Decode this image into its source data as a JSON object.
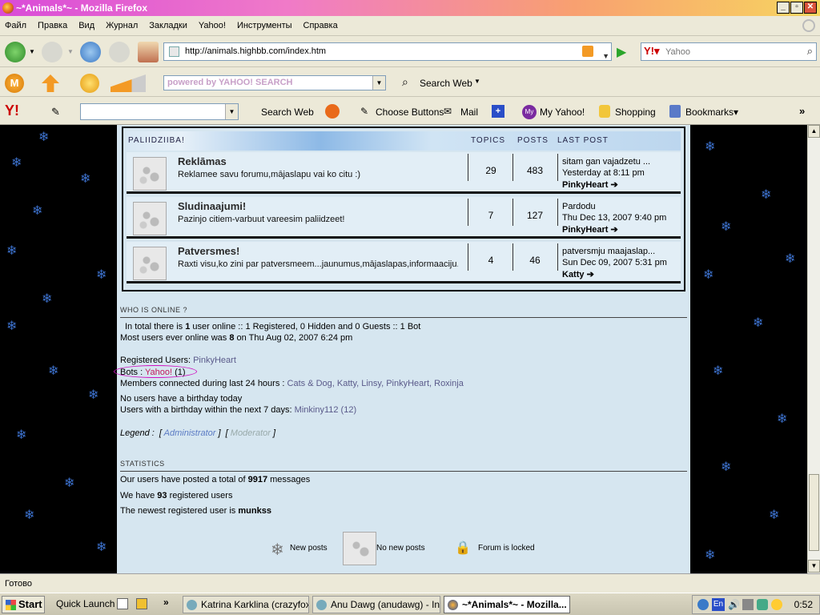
{
  "window": {
    "title": "~*Animals*~ - Mozilla Firefox"
  },
  "menu": [
    "Файл",
    "Правка",
    "Вид",
    "Журнал",
    "Закладки",
    "Yahoo!",
    "Инструменты",
    "Справка"
  ],
  "navigation": {
    "url": "http://animals.highbb.com/index.htm",
    "search_placeholder": "Yahoo"
  },
  "toolbar2": {
    "yahoo_search_label": "powered by YAHOO! SEARCH",
    "search_web": "Search Web"
  },
  "toolbar3": {
    "search_web": "Search Web",
    "choose_buttons": "Choose Buttons",
    "mail": "Mail",
    "my_yahoo": "My Yahoo!",
    "shopping": "Shopping",
    "bookmarks": "Bookmarks▾"
  },
  "forum": {
    "header": {
      "category": "PALIIDZIIBA!",
      "topics": "TOPICS",
      "posts": "POSTS",
      "last_post": "LAST POST"
    },
    "rows": [
      {
        "title": "Reklāmas",
        "desc": "Reklamee savu forumu,mājaslapu vai ko citu :)",
        "topics": "29",
        "posts": "483",
        "lp_title": "sitam gan vajadzetu ...",
        "lp_date": "Yesterday at 8:11 pm",
        "lp_user": "PinkyHeart"
      },
      {
        "title": "Sludinaajumi!",
        "desc": "Pazinjo citiem-varbuut vareesim paliidzeet!",
        "topics": "7",
        "posts": "127",
        "lp_title": "Pardodu",
        "lp_date": "Thu Dec 13, 2007 9:40 pm",
        "lp_user": "PinkyHeart"
      },
      {
        "title": "Patversmes!",
        "desc": "Raxti visu,ko zini par patversmeem...jaunumus,mājaslapas,informaaciju...",
        "topics": "4",
        "posts": "46",
        "lp_title": "patversmju maajaslap...",
        "lp_date": "Sun Dec 09, 2007 5:31 pm",
        "lp_user": "Katty"
      }
    ],
    "who_online": {
      "heading": "WHO IS ONLINE ?",
      "total_pre": "In total there is ",
      "total_num": "1",
      "total_post": " user online :: 1 Registered, 0 Hidden and 0 Guests :: 1 Bot",
      "most_pre": "Most users ever online was ",
      "most_num": "8",
      "most_post": " on Thu Aug 02, 2007 6:24 pm",
      "registered_label": "Registered Users: ",
      "registered_user": "PinkyHeart",
      "bots_label": "Bots : ",
      "bots_name": "Yahoo!",
      "bots_count": " (1)",
      "members_label": "Members connected during last 24 hours : ",
      "members": "Cats & Dog, Katty, Linsy, PinkyHeart, Roxinja",
      "no_birthday": "No users have a birthday today",
      "birthday_week_label": "Users with a birthday within the next 7 days: ",
      "birthday_week": "Minkiny112 (12)",
      "legend_label": "Legend : ",
      "legend_admin": "Administrator",
      "legend_mod": "Moderator"
    },
    "statistics": {
      "heading": "STATISTICS",
      "posts_pre": "Our users have posted a total of ",
      "posts_num": "9917",
      "posts_post": " messages",
      "users_pre": "We have ",
      "users_num": "93",
      "users_post": " registered users",
      "newest_pre": "The newest registered user is ",
      "newest_user": "munkss"
    },
    "legend_icons": {
      "new_posts": "New posts",
      "no_new_posts": "No new posts",
      "locked": "Forum is locked"
    }
  },
  "status_bar": {
    "text": "Готово"
  },
  "taskbar": {
    "start": "Start",
    "quick_launch": "Quick Launch",
    "tasks": [
      "Katrina Karklina (crazyfoxy...",
      "Anu Dawg (anudawg) - Ins...",
      "~*Animals*~ - Mozilla..."
    ],
    "clock": "0:52",
    "lang": "En"
  }
}
